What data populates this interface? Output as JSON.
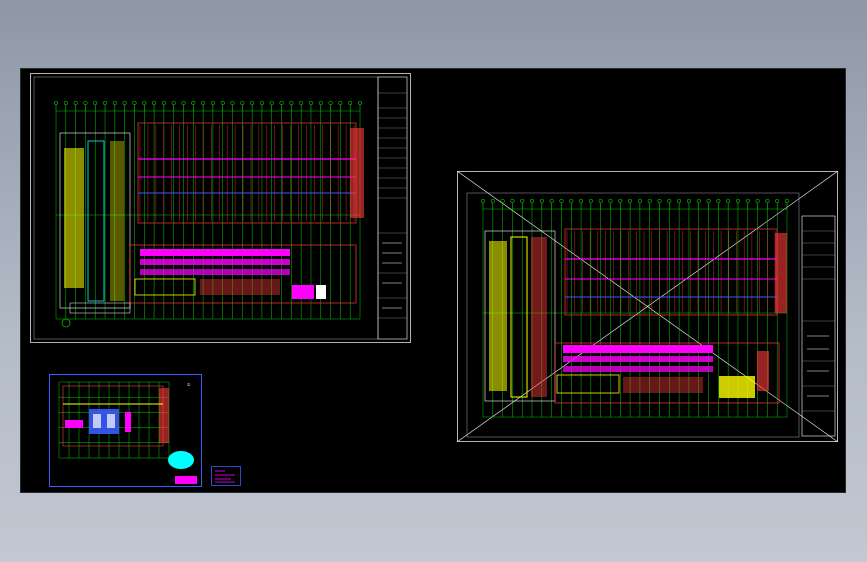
{
  "viewer": {
    "background_top": "#8d97a6",
    "background_bottom": "#c2c8d2",
    "canvas_color": "#000000"
  },
  "drawings": [
    {
      "id": "main-plan",
      "description_text": ""
    },
    {
      "id": "plan-copy-with-crosshair",
      "description_text": ""
    },
    {
      "id": "detail-plan",
      "marker": "①"
    },
    {
      "id": "legend-note"
    }
  ],
  "colors": {
    "grid_green": "#00ff00",
    "wall_red": "#ff3b3b",
    "fixture_magenta": "#ff00ff",
    "highlight_yellow": "#ffff00",
    "frame_white": "#ffffff",
    "cyan": "#00ffff",
    "blue": "#3a5bff"
  },
  "labels": {
    "detail_marker": "①"
  }
}
